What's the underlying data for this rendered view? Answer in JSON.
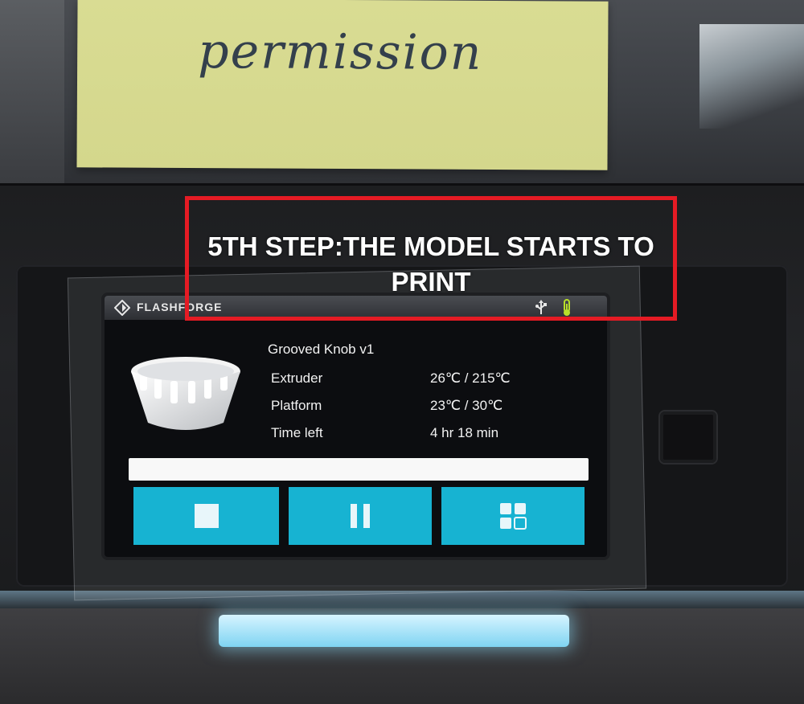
{
  "note": {
    "text": "permission"
  },
  "annotation": {
    "text": "5TH STEP:THE MODEL STARTS TO PRINT",
    "color": "#e51b24"
  },
  "screen": {
    "brand": "FLASHFORGE",
    "status_icons": [
      "usb-icon",
      "nozzle-temp-icon"
    ],
    "model_name": "Grooved Knob v1",
    "info": [
      {
        "label": "Extruder",
        "value": "26℃ / 215℃"
      },
      {
        "label": "Platform",
        "value": "23℃ / 30℃"
      },
      {
        "label": "Time left",
        "value": "4 hr 18 min"
      }
    ],
    "progress_percent": 100,
    "buttons": [
      {
        "name": "stop-button",
        "icon": "stop-icon"
      },
      {
        "name": "pause-button",
        "icon": "pause-icon"
      },
      {
        "name": "menu-button",
        "icon": "menu-grid-icon"
      }
    ],
    "accent_color": "#17b3d2"
  }
}
